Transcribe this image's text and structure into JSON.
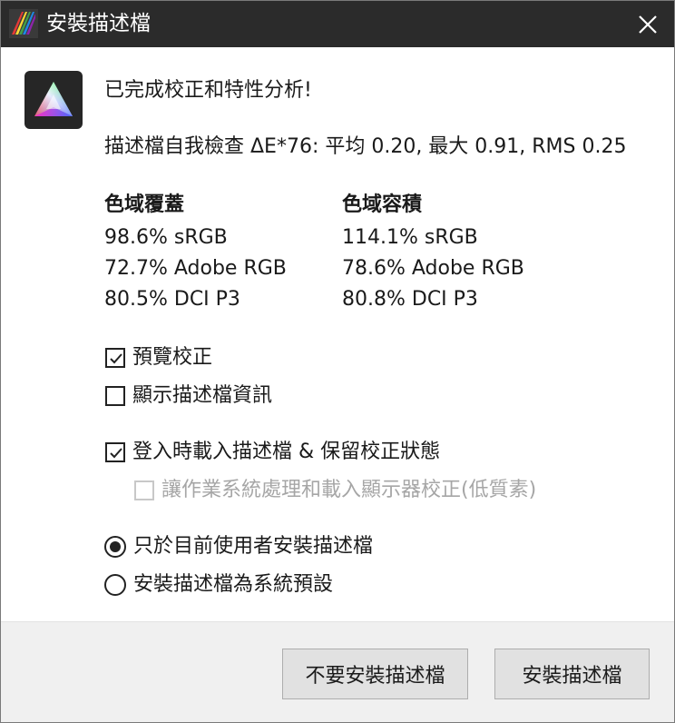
{
  "window": {
    "title": "安裝描述檔"
  },
  "main": {
    "headline": "已完成校正和特性分析!",
    "self_check": "描述檔自我檢查 ΔE*76: 平均 0.20, 最大 0.91, RMS 0.25",
    "coverage": {
      "heading": "色域覆蓋",
      "items": [
        "98.6% sRGB",
        "72.7% Adobe RGB",
        "80.5% DCI P3"
      ]
    },
    "volume": {
      "heading": "色域容積",
      "items": [
        "114.1% sRGB",
        "78.6% Adobe RGB",
        "80.8% DCI P3"
      ]
    }
  },
  "options": {
    "preview_calibration": {
      "label": "預覽校正",
      "checked": true
    },
    "show_profile_info": {
      "label": "顯示描述檔資訊",
      "checked": false
    },
    "load_on_login": {
      "label": "登入時載入描述檔 & 保留校正狀態",
      "checked": true
    },
    "os_handle": {
      "label": "讓作業系統處理和載入顯示器校正(低質素)",
      "checked": false,
      "disabled": true
    }
  },
  "install_scope": {
    "current_user": {
      "label": "只於目前使用者安裝描述檔",
      "selected": true
    },
    "system_default": {
      "label": "安裝描述檔為系統預設",
      "selected": false
    }
  },
  "buttons": {
    "dont_install": "不要安裝描述檔",
    "install": "安裝描述檔"
  },
  "colors": {
    "titlebar": "#2b2b2b",
    "footer": "#f0f0f0",
    "button": "#e1e1e1"
  }
}
